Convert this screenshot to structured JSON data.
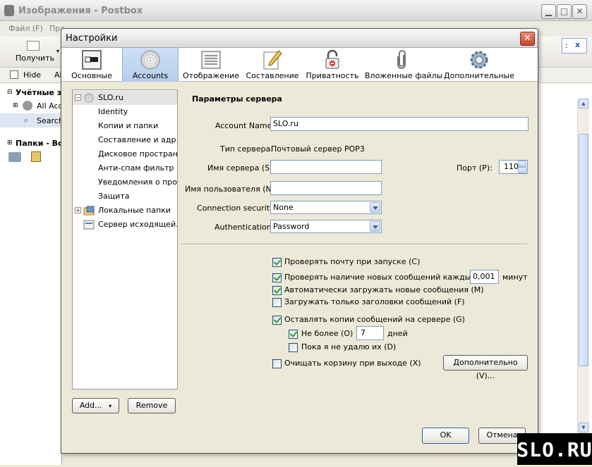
{
  "main_window": {
    "title": "Изображения - Postbox",
    "menu": [
      "Файл (F)",
      "Пра"
    ],
    "toolbar": {
      "get_mail": "Получить"
    },
    "toolbar2": {
      "hide": "Hide",
      "al": "Al"
    },
    "left_tree": {
      "accounts_header": "Учётные з",
      "all_accounts": "All Acco",
      "search": "Search",
      "folders_header": "Папки - Все"
    },
    "search_clear": "x"
  },
  "dialog": {
    "title": "Настройки",
    "tabs": [
      {
        "label": "Основные",
        "icon": "general-icon"
      },
      {
        "label": "Accounts",
        "icon": "at-sign-icon"
      },
      {
        "label": "Отображение",
        "icon": "display-icon"
      },
      {
        "label": "Составление",
        "icon": "compose-pencil-icon"
      },
      {
        "label": "Приватность",
        "icon": "privacy-lock-icon"
      },
      {
        "label": "Вложенные файлы",
        "icon": "paperclip-icon"
      },
      {
        "label": "Дополнительные",
        "icon": "gear-icon"
      }
    ],
    "active_tab": "Accounts",
    "tree": [
      {
        "label": "SLO.ru",
        "selected": true
      },
      {
        "label": "Identity"
      },
      {
        "label": "Копии и папки"
      },
      {
        "label": "Составление и адр..."
      },
      {
        "label": "Дисковое простран..."
      },
      {
        "label": "Анти-спам фильтр"
      },
      {
        "label": "Уведомления о про..."
      },
      {
        "label": "Защита"
      },
      {
        "label": "Локальные папки"
      },
      {
        "label": "Сервер исходящей..."
      }
    ],
    "add_button": "Add...",
    "remove_button": "Remove",
    "section_title": "Параметры сервера",
    "account_name_label": "Account Name:",
    "account_name_value": "SLO.ru",
    "server_type_label": "Тип сервера:",
    "server_type_value": "Почтовый сервер POP3",
    "server_name_label": "Имя сервера (S):",
    "server_name_value": "",
    "port_label": "Порт (P):",
    "port_value": "110",
    "username_label": "Имя пользователя (N):",
    "username_value": "",
    "connection_security_label": "Connection security:",
    "connection_security_value": "None",
    "authentication_label": "Authentication:",
    "authentication_value": "Password",
    "options": {
      "check_on_startup": {
        "label": "Проверять почту при запуске (C)",
        "checked": true
      },
      "check_every": {
        "label": "Проверять наличие новых сообщений каждые (Y)",
        "checked": true,
        "value": "0,001",
        "unit": "минут"
      },
      "auto_download": {
        "label": "Автоматически загружать новые сообщения (M)",
        "checked": true
      },
      "headers_only": {
        "label": "Загружать только заголовки сообщений (F)",
        "checked": false
      },
      "leave_on_server": {
        "label": "Оставлять копии сообщений на сервере (G)",
        "checked": true
      },
      "no_more_than": {
        "label": "Не более (O)",
        "checked": true,
        "value": "7",
        "unit": "дней"
      },
      "until_deleted": {
        "label": "Пока я не удалю их (D)",
        "checked": false
      },
      "empty_trash": {
        "label": "Очищать корзину при выходе (X)",
        "checked": false
      }
    },
    "advanced_button": "Дополнительно (V)...",
    "ok_button": "OK",
    "cancel_button": "Отмена"
  },
  "watermark": "SLO.RU"
}
